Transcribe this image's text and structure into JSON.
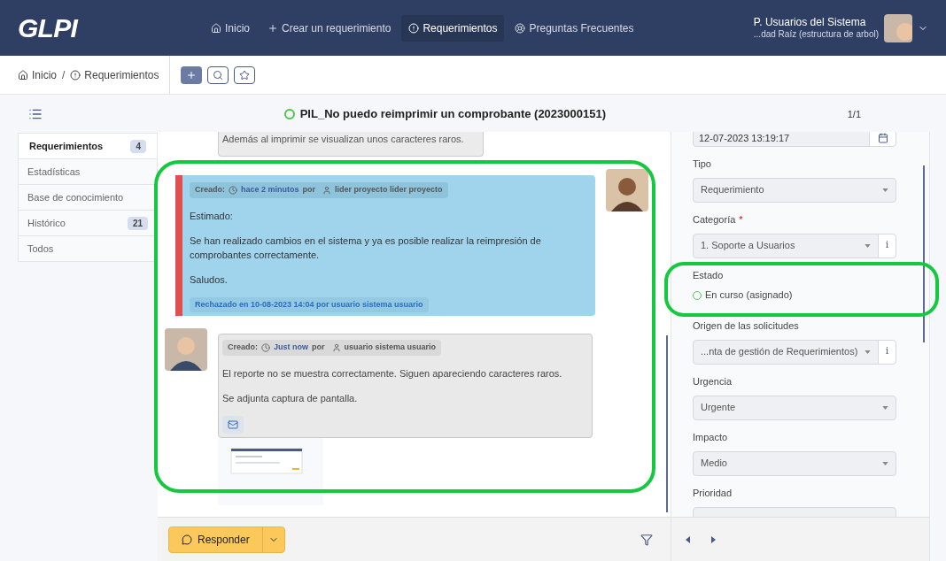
{
  "header": {
    "logo": "GLPI",
    "nav": [
      {
        "label": "Inicio",
        "selected": false
      },
      {
        "label": "Crear un requerimiento",
        "selected": false
      },
      {
        "label": "Requerimientos",
        "selected": true
      },
      {
        "label": "Preguntas Frecuentes",
        "selected": false
      }
    ],
    "user": {
      "name": "P. Usuarios del Sistema",
      "entity": "...dad Raíz (estructura de arbol)"
    }
  },
  "breadcrumb": {
    "separator": "/",
    "items": [
      {
        "label": "Inicio"
      },
      {
        "label": "Requerimientos"
      }
    ]
  },
  "ticket": {
    "title": "PIL_No puedo reimprimir un comprobante (2023000151)",
    "counter": "1/1"
  },
  "tabs": [
    {
      "label": "Requerimientos",
      "count": "4",
      "selected": true
    },
    {
      "label": "Estadísticas",
      "selected": false
    },
    {
      "label": "Base de conocimiento",
      "selected": false
    },
    {
      "label": "Histórico",
      "count": "21",
      "selected": false
    },
    {
      "label": "Todos",
      "selected": false
    }
  ],
  "timeline": {
    "previous_text": "Además al imprimir se visualizan unos caracteres raros.",
    "items": [
      {
        "kind": "solution",
        "created_label": "Creado:",
        "time": "hace 2 minutos",
        "by": "por",
        "author": "lider proyecto lider proyecto",
        "paragraphs": [
          "Estimado:",
          "Se han realizado cambios en el sistema y ya es posible realizar la reimpresión de comprobantes correctamente.",
          "Saludos."
        ],
        "footer": "Rechazado en 10-08-2023 14:04 por usuario sistema usuario"
      },
      {
        "kind": "followup",
        "created_label": "Creado:",
        "time": "Just now",
        "by": "por",
        "author": "usuario sistema usuario",
        "paragraphs": [
          "El reporte no se muestra correctamente. Siguen apareciendo caracteres raros.",
          "Se adjunta captura de pantalla."
        ],
        "attachment": true
      }
    ]
  },
  "reply_button": "Responder",
  "fields": [
    {
      "kind": "date",
      "value": "12-07-2023 13:19:17"
    },
    {
      "kind": "select",
      "label": "Tipo",
      "value": "Requerimiento"
    },
    {
      "kind": "select_info",
      "label": "Categoría",
      "required_mark": "*",
      "value": "1. Soporte a Usuarios",
      "info": "i"
    },
    {
      "kind": "status",
      "label": "Estado",
      "value": "En curso (asignado)"
    },
    {
      "kind": "select_info",
      "label": "Origen de las solicitudes",
      "value": "...nta de gestión de Requerimientos)",
      "info": "i"
    },
    {
      "kind": "select",
      "label": "Urgencia",
      "value": "Urgente"
    },
    {
      "kind": "select",
      "label": "Impacto",
      "value": "Medio"
    },
    {
      "kind": "cut",
      "label": "Prioridad"
    }
  ]
}
